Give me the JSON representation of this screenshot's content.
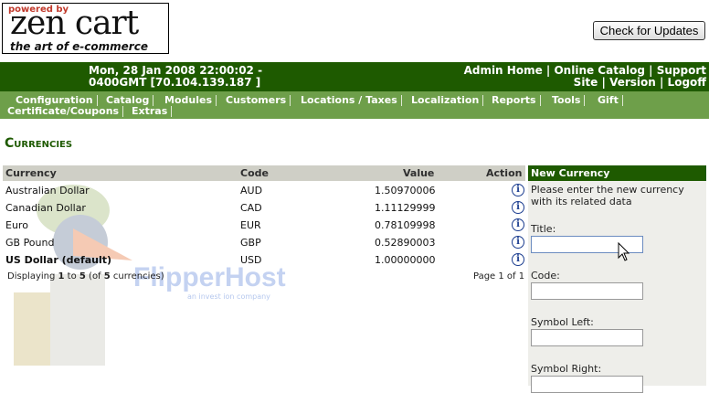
{
  "logo": {
    "powered_by": "powered by",
    "brand": "zen cart",
    "tagline": "the art of e-commerce"
  },
  "update_button": {
    "label": "Check for Updates"
  },
  "topbar": {
    "date_line1": "Mon, 28 Jan 2008 22:00:02 -",
    "date_line2": "0400GMT [70.104.139.187 ]",
    "links": [
      "Admin Home",
      "Online Catalog",
      "Support Site",
      "Version",
      "Logoff"
    ]
  },
  "menu": {
    "items": [
      "Configuration",
      "Catalog",
      "Modules",
      "Customers",
      "Locations / Taxes",
      "Localization",
      "Reports",
      "Tools",
      "Gift Certificate/Coupons",
      "Extras"
    ]
  },
  "page": {
    "title": "Currencies"
  },
  "table": {
    "headers": {
      "currency": "Currency",
      "code": "Code",
      "value": "Value",
      "action": "Action"
    },
    "rows": [
      {
        "currency": "Australian Dollar",
        "code": "AUD",
        "value": "1.50970006"
      },
      {
        "currency": "Canadian Dollar",
        "code": "CAD",
        "value": "1.11129999"
      },
      {
        "currency": "Euro",
        "code": "EUR",
        "value": "0.78109998"
      },
      {
        "currency": "GB Pound",
        "code": "GBP",
        "value": "0.52890003"
      },
      {
        "currency": "US Dollar (default)",
        "code": "USD",
        "value": "1.00000000"
      }
    ],
    "footer": {
      "displaying_prefix": "Displaying ",
      "from": "1",
      "to_word": " to ",
      "to": "5",
      "of_prefix": " (of ",
      "total": "5",
      "of_suffix": " currencies)",
      "page_text": "Page 1 of 1"
    }
  },
  "new_currency": {
    "header": "New Currency",
    "intro": "Please enter the new currency with its related data",
    "fields": [
      {
        "label": "Title:",
        "value": ""
      },
      {
        "label": "Code:",
        "value": ""
      },
      {
        "label": "Symbol Left:",
        "value": ""
      },
      {
        "label": "Symbol Right:",
        "value": ""
      }
    ]
  },
  "watermark": {
    "text": "FlipperHost",
    "sub": "an invest ion company"
  },
  "colors": {
    "dark_green": "#1e5a00",
    "menu_green": "#6e9f4a",
    "header_gray": "#cfcfc6",
    "panel_gray": "#eeeeea"
  }
}
